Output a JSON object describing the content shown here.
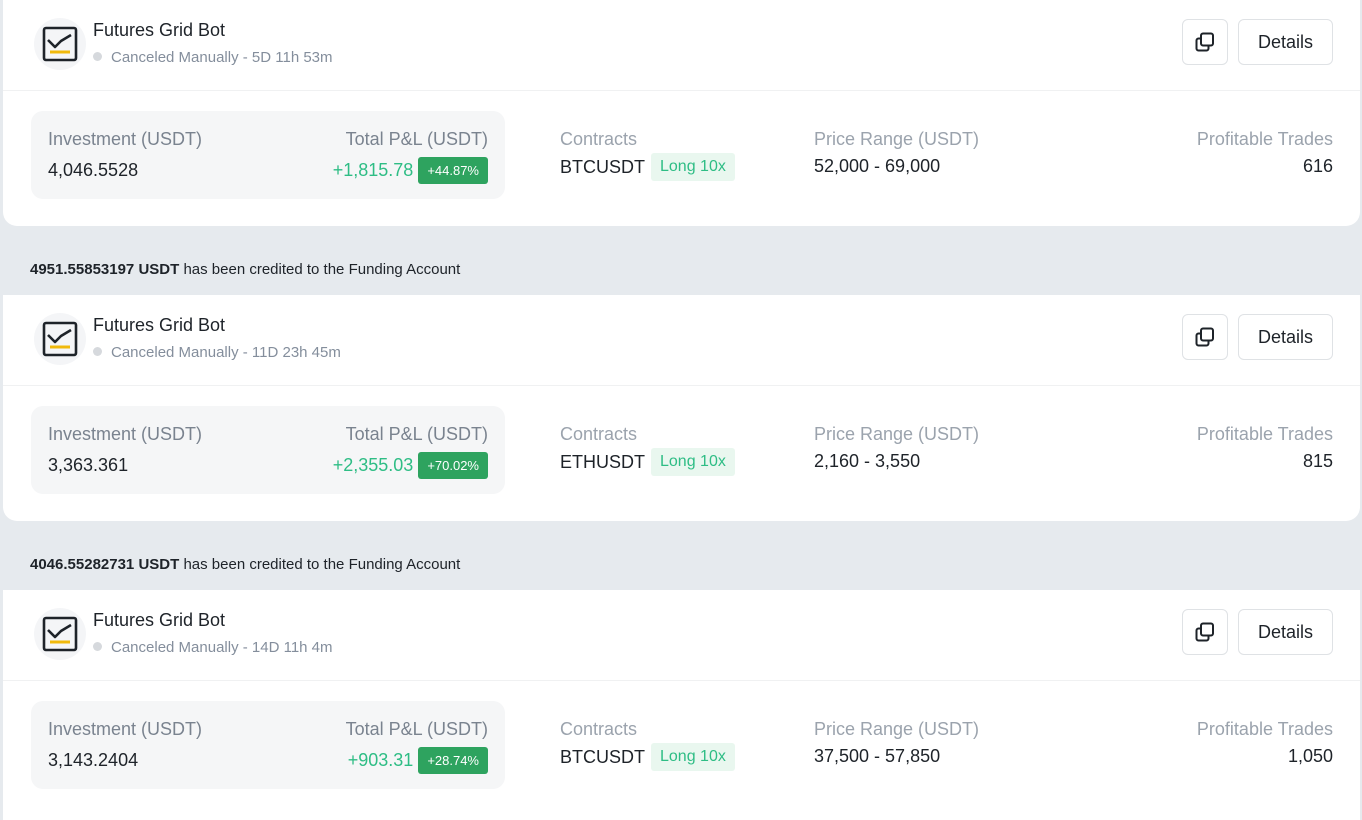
{
  "bots": [
    {
      "name": "Futures Grid Bot",
      "status": "Canceled Manually - 5D 11h 53m",
      "details_label": "Details",
      "investment_label": "Investment (USDT)",
      "investment_value": "4,046.5528",
      "pnl_label": "Total P&L (USDT)",
      "pnl_value": "+1,815.78",
      "pnl_percent": "+44.87%",
      "contracts_label": "Contracts",
      "contract_symbol": "BTCUSDT",
      "contract_tag": "Long 10x",
      "price_range_label": "Price Range (USDT)",
      "price_range_value": "52,000 - 69,000",
      "profitable_trades_label": "Profitable Trades",
      "profitable_trades_value": "616"
    },
    {
      "name": "Futures Grid Bot",
      "status": "Canceled Manually - 11D 23h 45m",
      "details_label": "Details",
      "investment_label": "Investment (USDT)",
      "investment_value": "3,363.361",
      "pnl_label": "Total P&L (USDT)",
      "pnl_value": "+2,355.03",
      "pnl_percent": "+70.02%",
      "contracts_label": "Contracts",
      "contract_symbol": "ETHUSDT",
      "contract_tag": "Long 10x",
      "price_range_label": "Price Range (USDT)",
      "price_range_value": "2,160 - 3,550",
      "profitable_trades_label": "Profitable Trades",
      "profitable_trades_value": "815"
    },
    {
      "name": "Futures Grid Bot",
      "status": "Canceled Manually - 14D 11h 4m",
      "details_label": "Details",
      "investment_label": "Investment (USDT)",
      "investment_value": "3,143.2404",
      "pnl_label": "Total P&L (USDT)",
      "pnl_value": "+903.31",
      "pnl_percent": "+28.74%",
      "contracts_label": "Contracts",
      "contract_symbol": "BTCUSDT",
      "contract_tag": "Long 10x",
      "price_range_label": "Price Range (USDT)",
      "price_range_value": "37,500 - 57,850",
      "profitable_trades_label": "Profitable Trades",
      "profitable_trades_value": "1,050"
    }
  ],
  "banners": [
    {
      "amount": "4951.55853197 USDT",
      "text": " has been credited to the Funding Account"
    },
    {
      "amount": "4046.55282731 USDT",
      "text": " has been credited to the Funding Account"
    }
  ],
  "colors": {
    "profit_green": "#2ebd85",
    "pnl_badge_green": "#2ea35f",
    "bot_icon_accent": "#f0b90b"
  },
  "icons": {
    "bot": "line-chart-icon",
    "copy": "copy-icon"
  }
}
